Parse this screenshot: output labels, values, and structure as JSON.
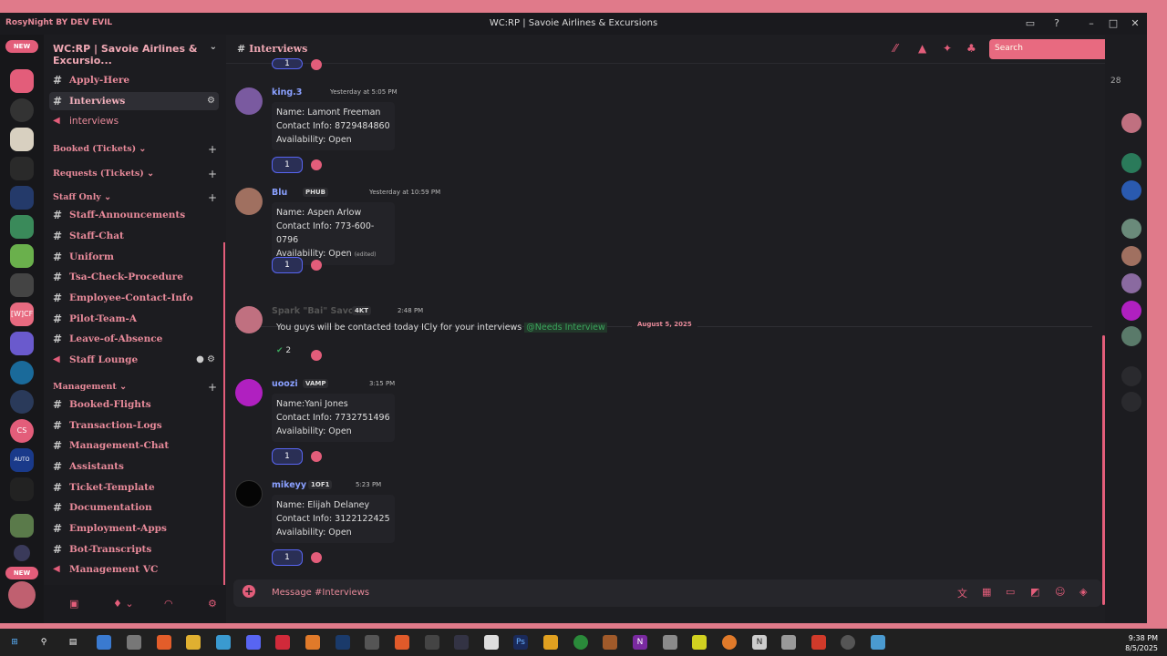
{
  "window": {
    "brand": "RosyNight BY DEV EVIL",
    "title": "WC:RP | Savoie Airlines & Excursions"
  },
  "servers": {
    "new_top": "NEW",
    "new_bottom": "NEW",
    "labels": [
      "[W]CF",
      "CS",
      "AUTO"
    ]
  },
  "sidebar": {
    "guild_name": "WC:RP | Savoie Airlines & Excursio...",
    "channels_top": [
      {
        "label": "Apply-Here",
        "type": "text"
      },
      {
        "label": "Interviews",
        "type": "text"
      },
      {
        "label": "interviews",
        "type": "voice"
      }
    ],
    "categories": {
      "booked": "Booked (Tickets)",
      "requests": "Requests (Tickets)",
      "staff": "Staff Only",
      "management": "Management"
    },
    "staff_channels": [
      "Staff-Announcements",
      "Staff-Chat",
      "Uniform",
      "Tsa-Check-Procedure",
      "Employee-Contact-Info",
      "Pilot-Team-A",
      "Leave-of-Absence"
    ],
    "staff_voice": "Staff Lounge",
    "management_channels": [
      "Booked-Flights",
      "Transaction-Logs",
      "Management-Chat",
      "Assistants",
      "Ticket-Template",
      "Documentation",
      "Employment-Apps",
      "Bot-Transcripts"
    ],
    "management_voice": "Management VC"
  },
  "header": {
    "channel": "Interviews",
    "search_placeholder": "Search"
  },
  "messages": [
    {
      "user": "king.3",
      "time": "Yesterday at 5:05 PM",
      "lines": [
        "Name: Lamont Freeman",
        "Contact Info: 8729484860",
        "Availability: Open"
      ],
      "reaction": "1",
      "tag": ""
    },
    {
      "user": "Blu",
      "time": "Yesterday at 10:59 PM",
      "lines": [
        "Name: Aspen Arlow",
        "Contact Info: 773-600-0796",
        "Availability: Open"
      ],
      "edited": "(edited)",
      "reaction": "1",
      "tag": "PHUB"
    },
    {
      "user": "Spark \"Bai\" Savoie",
      "time": "2:48 PM",
      "text": "You guys will be contacted today ICly for your interviews",
      "mention": "@Needs Interview",
      "reaction": "2",
      "tag": "4KT"
    },
    {
      "user": "uoozi",
      "time": "3:15 PM",
      "lines": [
        "Name:Yani Jones",
        "Contact Info: 7732751496",
        "Availability: Open"
      ],
      "reaction": "1",
      "tag": "VAMP"
    },
    {
      "user": "mikeyy",
      "time": "5:23 PM",
      "lines": [
        "Name: Elijah Delaney",
        "Contact Info: 3122122425",
        "Availability: Open"
      ],
      "reaction": "1",
      "tag": "1OF1"
    }
  ],
  "date_separator": "August 5, 2025",
  "top_reaction": "1",
  "composer": {
    "placeholder": "Message #Interviews"
  },
  "members": {
    "count": "28"
  },
  "taskbar": {
    "time": "9:38 PM",
    "date": "8/5/2025"
  },
  "colors": {
    "accent": "#e35d7a",
    "pink_text": "#e88a9a",
    "mention": "#3ba55c",
    "reaction_border": "#5865f2"
  }
}
